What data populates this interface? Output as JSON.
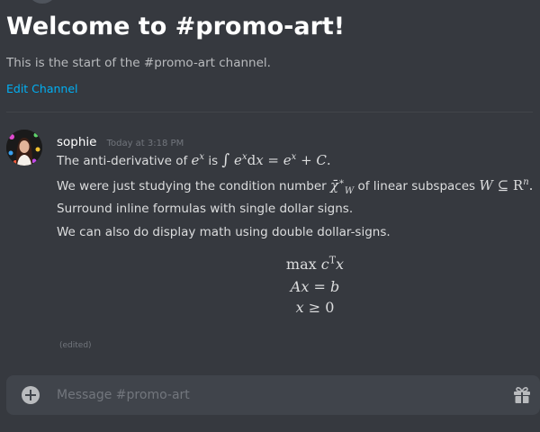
{
  "welcome": {
    "title": "Welcome to #promo-art!",
    "subtitle": "This is the start of the #promo-art channel.",
    "edit_channel_label": "Edit Channel"
  },
  "message": {
    "author": "sophie",
    "timestamp": "Today at 3:18 PM",
    "edited_label": "(edited)",
    "line1": {
      "prefix": "The anti-derivative of ",
      "middle": " is "
    },
    "line2": {
      "prefix": "We were just studying the condition number ",
      "middle": " of linear subspaces "
    },
    "line3": "Surround inline formulas with single dollar signs.",
    "line4": "We can also do display math using double dollar-signs."
  },
  "composer": {
    "placeholder": "Message #promo-art"
  },
  "icons": {
    "attach": "plus-circle-icon",
    "gift": "gift-icon"
  },
  "colors": {
    "background": "#36393f",
    "link": "#00b0f4",
    "composer": "#40444b",
    "text": "#dcddde",
    "muted": "#72767d"
  }
}
